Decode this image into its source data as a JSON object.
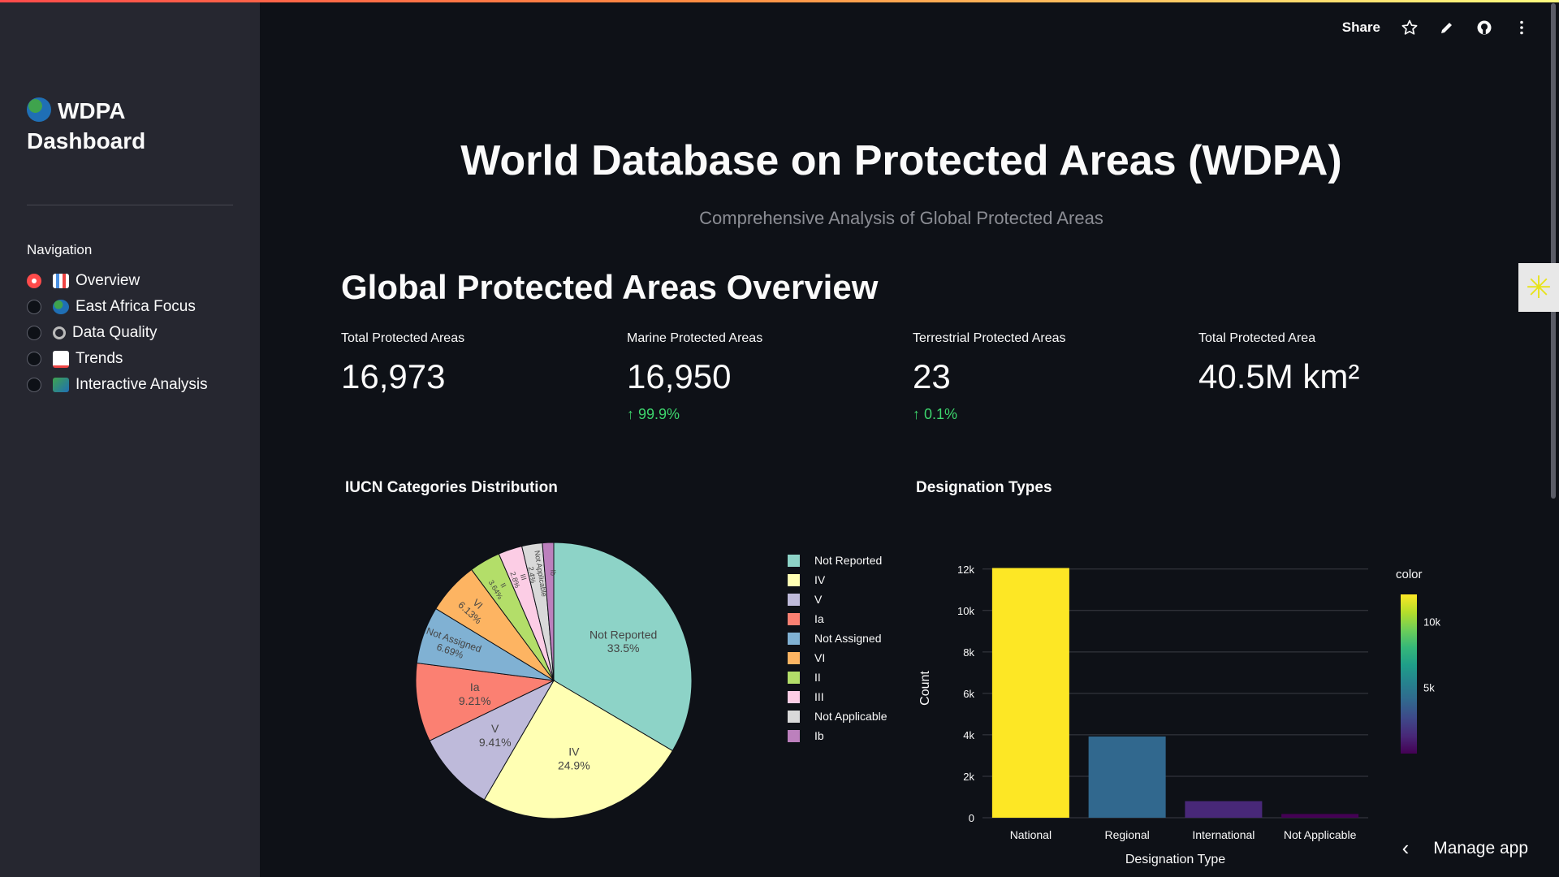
{
  "sidebar": {
    "brand_line1": "WDPA",
    "brand_line2": "Dashboard",
    "nav_label": "Navigation",
    "items": [
      {
        "label": "Overview",
        "selected": true,
        "icon": "bar-chart-emoji"
      },
      {
        "label": "East Africa Focus",
        "selected": false,
        "icon": "globe-emoji"
      },
      {
        "label": "Data Quality",
        "selected": false,
        "icon": "magnifier-emoji"
      },
      {
        "label": "Trends",
        "selected": false,
        "icon": "chart-increasing-emoji"
      },
      {
        "label": "Interactive Analysis",
        "selected": false,
        "icon": "map-emoji"
      }
    ]
  },
  "toolbar": {
    "share_label": "Share",
    "icons": [
      "star-icon",
      "pencil-icon",
      "github-icon",
      "more-vertical-icon"
    ]
  },
  "header": {
    "title": "World Database on Protected Areas (WDPA)",
    "subtitle": "Comprehensive Analysis of Global Protected Areas"
  },
  "overview": {
    "title": "Global Protected Areas Overview",
    "metrics": [
      {
        "label": "Total Protected Areas",
        "value": "16,973",
        "delta": ""
      },
      {
        "label": "Marine Protected Areas",
        "value": "16,950",
        "delta": "99.9%"
      },
      {
        "label": "Terrestrial Protected Areas",
        "value": "23",
        "delta": "0.1%"
      },
      {
        "label": "Total Protected Area",
        "value": "40.5M km²",
        "delta": ""
      }
    ]
  },
  "manage_app_label": "Manage app",
  "colors": {
    "accent": "#ff4b4b",
    "delta_up": "#3dd56d",
    "sidebar_bg": "#262730",
    "page_bg": "#0e1117"
  },
  "chart_data": [
    {
      "type": "pie",
      "title": "IUCN Categories Distribution",
      "labels": [
        "Not Reported",
        "IV",
        "V",
        "Ia",
        "Not Assigned",
        "VI",
        "II",
        "III",
        "Not Applicable",
        "Ib"
      ],
      "values": [
        33.5,
        24.9,
        9.41,
        9.21,
        6.69,
        6.13,
        3.64,
        2.8,
        2.4,
        1.32
      ],
      "text_labels": [
        "33.5%",
        "24.9%",
        "9.41%",
        "9.21%",
        "6.69%",
        "6.13%",
        "3.64%",
        "2.8%",
        "2.4%",
        ""
      ],
      "colors": [
        "#8dd3c7",
        "#ffffb3",
        "#bebada",
        "#fb8072",
        "#80b1d3",
        "#fdb462",
        "#b3de69",
        "#fccde5",
        "#d9d9d9",
        "#bc80bd"
      ],
      "legend_position": "right"
    },
    {
      "type": "bar",
      "title": "Designation Types",
      "categories": [
        "National",
        "Regional",
        "International",
        "Not Applicable"
      ],
      "values": [
        12050,
        3920,
        800,
        180
      ],
      "xlabel": "Designation Type",
      "ylabel": "Count",
      "ylim": [
        0,
        12500
      ],
      "yticks": [
        0,
        2000,
        4000,
        6000,
        8000,
        10000,
        12000
      ],
      "ytick_labels": [
        "0",
        "2k",
        "4k",
        "6k",
        "8k",
        "10k",
        "12k"
      ],
      "colorbar": {
        "title": "color",
        "ticks": [
          5000,
          10000
        ],
        "tick_labels": [
          "5k",
          "10k"
        ],
        "range": [
          0,
          12050
        ]
      },
      "grid": true
    }
  ]
}
